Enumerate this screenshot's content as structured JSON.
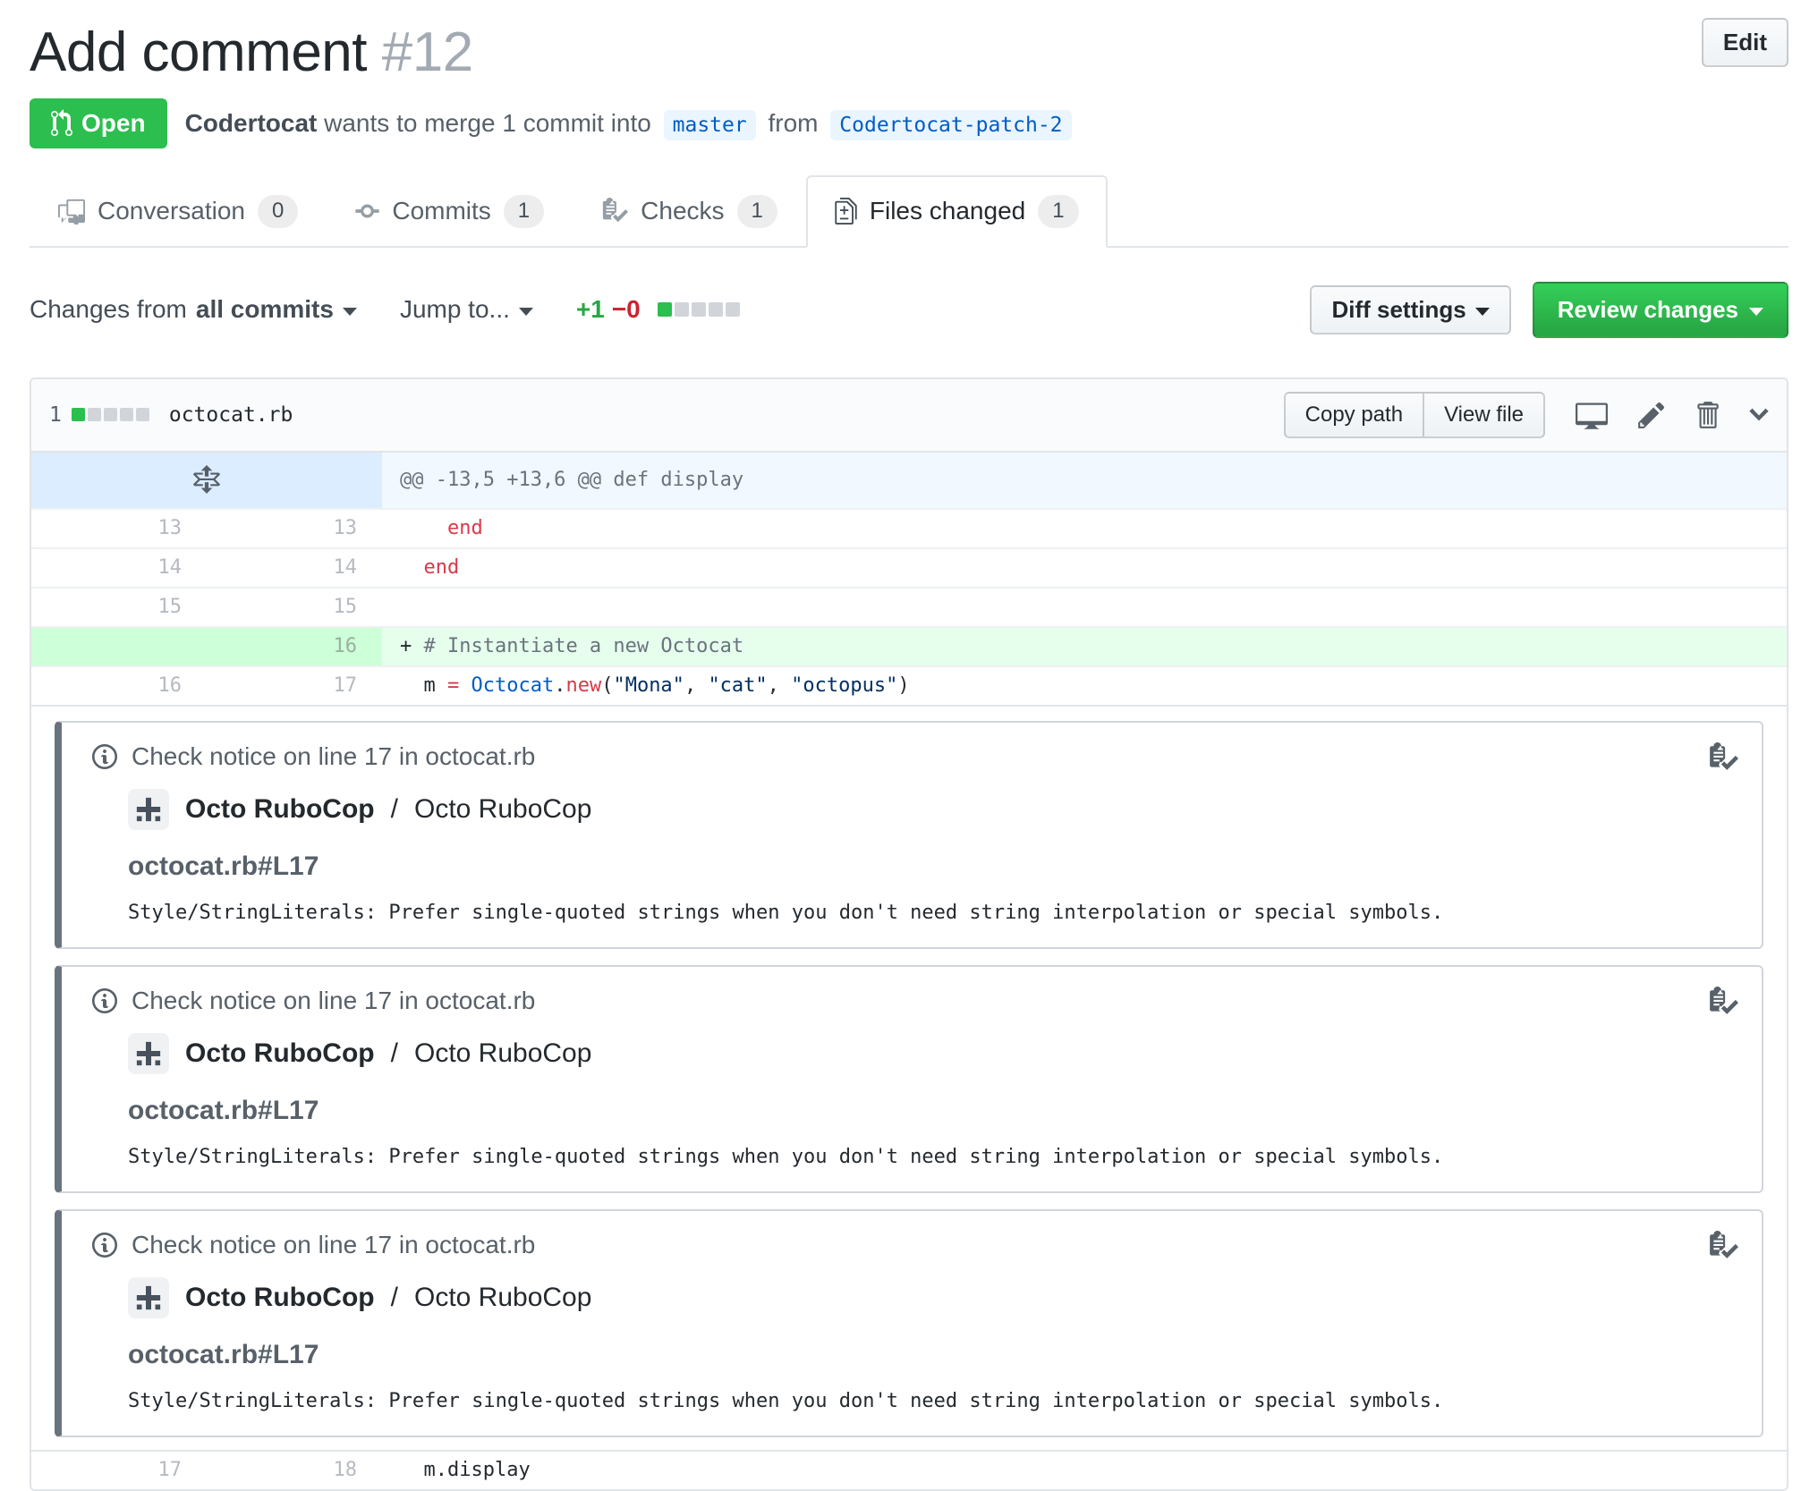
{
  "page": {
    "title": "Add comment",
    "number": "#12",
    "edit_button": "Edit"
  },
  "status": {
    "label": "Open"
  },
  "byline": {
    "author": "Codertocat",
    "action": "wants to merge 1 commit into",
    "base_branch": "master",
    "from_word": "from",
    "head_branch": "Codertocat-patch-2"
  },
  "tabs": [
    {
      "label": "Conversation",
      "count": "0",
      "icon": "comment-discussion-icon",
      "active": false
    },
    {
      "label": "Commits",
      "count": "1",
      "icon": "git-commit-icon",
      "active": false
    },
    {
      "label": "Checks",
      "count": "1",
      "icon": "checklist-icon",
      "active": false
    },
    {
      "label": "Files changed",
      "count": "1",
      "icon": "file-diff-icon",
      "active": true
    }
  ],
  "toolbar": {
    "changes_from": "Changes from",
    "scope": "all commits",
    "jump_to": "Jump to...",
    "additions": "+1",
    "deletions": "−0",
    "diff_settings": "Diff settings",
    "review_changes": "Review changes"
  },
  "diffstat": {
    "blocks": [
      "added",
      "neutral",
      "neutral",
      "neutral",
      "neutral"
    ]
  },
  "file": {
    "changes_count": "1",
    "name": "octocat.rb",
    "copy_path": "Copy path",
    "view_file": "View file"
  },
  "diff": {
    "hunk_header": "@@ -13,5 +13,6 @@ def display",
    "rows": [
      {
        "old": "13",
        "new": "13",
        "type": "context",
        "segments": [
          {
            "t": "    ",
            "c": "plain"
          },
          {
            "t": "end",
            "c": "keyword"
          }
        ]
      },
      {
        "old": "14",
        "new": "14",
        "type": "context",
        "segments": [
          {
            "t": "  ",
            "c": "plain"
          },
          {
            "t": "end",
            "c": "keyword"
          }
        ]
      },
      {
        "old": "15",
        "new": "15",
        "type": "context",
        "segments": []
      },
      {
        "old": "",
        "new": "16",
        "type": "addition",
        "segments": [
          {
            "t": "+ ",
            "c": "plain"
          },
          {
            "t": "# Instantiate a new Octocat",
            "c": "comment"
          }
        ]
      },
      {
        "old": "16",
        "new": "17",
        "type": "context",
        "segments": [
          {
            "t": "  m ",
            "c": "plain"
          },
          {
            "t": "=",
            "c": "keyword"
          },
          {
            "t": " ",
            "c": "plain"
          },
          {
            "t": "Octocat",
            "c": "constant"
          },
          {
            "t": ".",
            "c": "plain"
          },
          {
            "t": "new",
            "c": "keyword"
          },
          {
            "t": "(",
            "c": "plain"
          },
          {
            "t": "\"Mona\"",
            "c": "string"
          },
          {
            "t": ", ",
            "c": "plain"
          },
          {
            "t": "\"cat\"",
            "c": "string"
          },
          {
            "t": ", ",
            "c": "plain"
          },
          {
            "t": "\"octopus\"",
            "c": "string"
          },
          {
            "t": ")",
            "c": "plain"
          }
        ]
      }
    ],
    "last_row": {
      "old": "17",
      "new": "18",
      "segments": [
        {
          "t": "  m.display",
          "c": "plain"
        }
      ]
    }
  },
  "annotations": [
    {
      "title": "Check notice on line 17 in octocat.rb",
      "app_name": "Octo RuboCop",
      "separator": "/",
      "context": "Octo RuboCop",
      "path_line": "octocat.rb#L17",
      "message": "Style/StringLiterals: Prefer single-quoted strings when you don't need string interpolation or special symbols."
    },
    {
      "title": "Check notice on line 17 in octocat.rb",
      "app_name": "Octo RuboCop",
      "separator": "/",
      "context": "Octo RuboCop",
      "path_line": "octocat.rb#L17",
      "message": "Style/StringLiterals: Prefer single-quoted strings when you don't need string interpolation or special symbols."
    },
    {
      "title": "Check notice on line 17 in octocat.rb",
      "app_name": "Octo RuboCop",
      "separator": "/",
      "context": "Octo RuboCop",
      "path_line": "octocat.rb#L17",
      "message": "Style/StringLiterals: Prefer single-quoted strings when you don't need string interpolation or special symbols."
    }
  ],
  "colors": {
    "accent_green": "#2cbe4e",
    "added_text": "#28a745",
    "removed_text": "#cb2431",
    "branch_bg": "#eaf5ff",
    "branch_fg": "#005cc5",
    "hunk_bg": "#f1f8ff",
    "hunk_gutter_bg": "#dbedff",
    "addition_bg": "#e6ffed",
    "addition_gutter_bg": "#cdffd8",
    "keyword": "#d73a49",
    "constant": "#005cc5",
    "string": "#032f62",
    "comment": "#6a737d"
  }
}
